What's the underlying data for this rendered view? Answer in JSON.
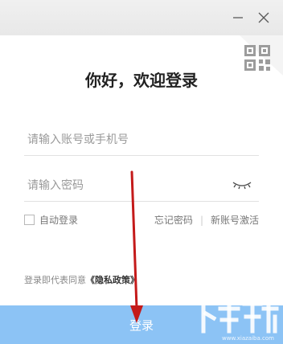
{
  "window": {
    "minimize_icon": "minimize-icon",
    "close_icon": "close-icon",
    "qr_icon": "qr-code-icon"
  },
  "login": {
    "heading": "你好，欢迎登录",
    "account_placeholder": "请输入账号或手机号",
    "password_placeholder": "请输入密码",
    "eye_icon": "eye-closed-icon",
    "remember_label": "自动登录",
    "remember_checked": false,
    "forgot_password": "忘记密码",
    "separator": "|",
    "register": "新账号激活",
    "agreement_prefix": "登录即代表同意",
    "agreement_link": "《隐私政策》",
    "submit_label": "登录"
  },
  "colors": {
    "button_bg": "#8cc3f5",
    "arrow": "#c41a1a"
  },
  "watermark": {
    "url": "www.xiazaiba.com"
  }
}
